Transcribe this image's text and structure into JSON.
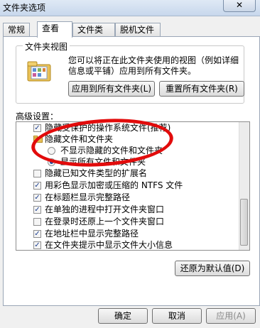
{
  "window": {
    "title": "文件夹选项",
    "close_glyph": "✕"
  },
  "tabs": [
    {
      "label": "常规"
    },
    {
      "label": "查看"
    },
    {
      "label": "文件类型"
    },
    {
      "label": "脱机文件"
    }
  ],
  "folder_view": {
    "group_title": "文件夹视图",
    "description_line1": "您可以将正在此文件夹使用的视图（例如详细",
    "description_line2": "信息或平铺）应用到所有文件夹。",
    "apply_button": "应用到所有文件夹(L)",
    "reset_button": "重置所有文件夹(R)"
  },
  "advanced": {
    "label": "高级设置：",
    "items": [
      {
        "type": "checkbox",
        "checked": true,
        "label": "隐藏受保护的操作系统文件(推荐)"
      },
      {
        "type": "folder",
        "label": "隐藏文件和文件夹"
      },
      {
        "type": "radio",
        "checked": false,
        "label": "不显示隐藏的文件和文件夹"
      },
      {
        "type": "radio",
        "checked": true,
        "label": "显示所有文件和文件夹"
      },
      {
        "type": "checkbox",
        "checked": false,
        "label": "隐藏已知文件类型的扩展名"
      },
      {
        "type": "checkbox",
        "checked": true,
        "label": "用彩色显示加密或压缩的 NTFS 文件"
      },
      {
        "type": "checkbox",
        "checked": true,
        "label": "在标题栏显示完整路径"
      },
      {
        "type": "checkbox",
        "checked": true,
        "label": "在单独的进程中打开文件夹窗口"
      },
      {
        "type": "checkbox",
        "checked": false,
        "label": "在登录时还原上一个文件夹窗口"
      },
      {
        "type": "checkbox",
        "checked": true,
        "label": "在地址栏中显示完整路径"
      },
      {
        "type": "checkbox",
        "checked": true,
        "label": "在文件夹提示中显示文件大小信息"
      }
    ],
    "restore_defaults": "还原为默认值(D)"
  },
  "footer": {
    "ok": "确定",
    "cancel": "取消",
    "apply": "应用(A)"
  },
  "colors": {
    "annotation_oval": "#e20b0b",
    "check": "#1c3f8f"
  }
}
